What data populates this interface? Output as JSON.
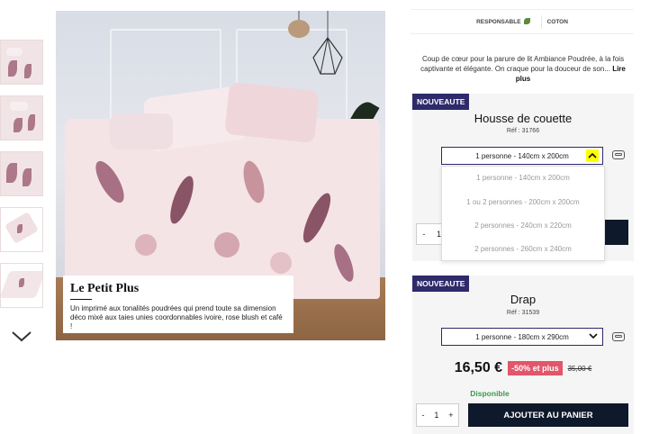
{
  "badges": [
    "RESPONSABLE",
    "COTON"
  ],
  "description": {
    "text": "Coup de cœur pour la parure de lit Ambiance Poudrée, à la fois captivante et élégante. On craque pour la douceur de son...",
    "more": "Lire plus"
  },
  "caption": {
    "title": "Le Petit Plus",
    "text": "Un imprimé aux tonalités poudrées qui prend toute sa dimension déco mixé aux taies unies coordonnables ivoire, rose blush et café !"
  },
  "product1": {
    "badge": "NOUVEAUTE",
    "title": "Housse de couette",
    "ref": "Réf : 31766",
    "selected": "1 personne - 140cm x 200cm",
    "options": [
      "1 personne - 140cm x 200cm",
      "1 ou 2 personnes - 200cm x 200cm",
      "2 personnes - 240cm x 220cm",
      "2 personnes - 260cm x 240cm"
    ],
    "qty_minus": "-",
    "qty": "1"
  },
  "product2": {
    "badge": "NOUVEAUTE",
    "title": "Drap",
    "ref": "Réf : 31539",
    "selected": "1 personne - 180cm x 290cm",
    "price": "16,50 €",
    "promo": "-50% et plus",
    "old_price": "35,00 €",
    "availability": "Disponible",
    "qty_minus": "-",
    "qty": "1",
    "qty_plus": "+",
    "add_to_cart": "AJOUTER AU PANIER"
  },
  "colors": {
    "navy": "#2e2a6b",
    "cart": "#0e1a2b",
    "promo": "#e2556a",
    "available": "#3b9a4a",
    "highlight": "#ffff00"
  },
  "icons": [
    "leaf-icon",
    "chevron-up-icon",
    "chevron-down-icon",
    "size-icon"
  ]
}
